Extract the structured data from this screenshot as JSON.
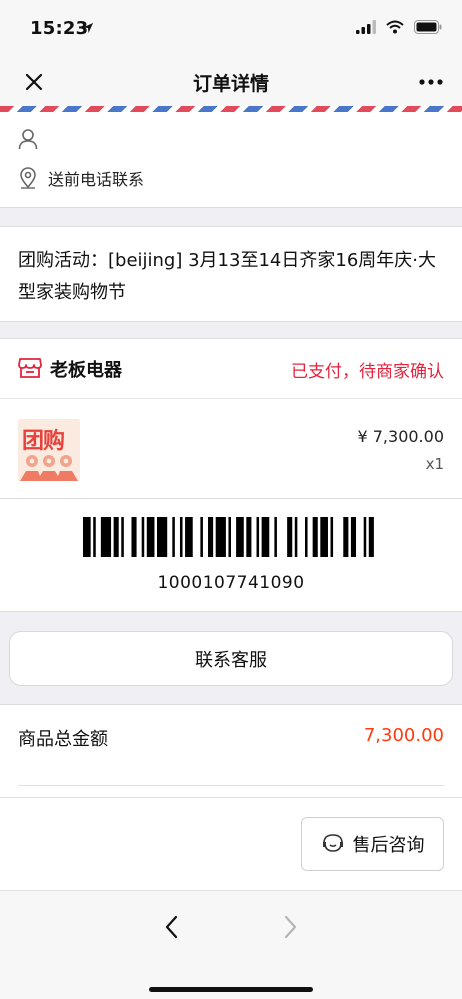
{
  "status_bar": {
    "time": "15:23"
  },
  "nav": {
    "title": "订单详情"
  },
  "contact": {
    "note": "送前电话联系"
  },
  "activity": {
    "text": "团购活动：[beijing] 3月13至14日齐家16周年庆·大型家装购物节"
  },
  "store": {
    "name": "老板电器",
    "status": "已支付，待商家确认"
  },
  "product": {
    "thumb_label": "团购",
    "price": "¥ 7,300.00",
    "qty": "x1"
  },
  "barcode": {
    "number": "1000107741090"
  },
  "buttons": {
    "contact_service": "联系客服",
    "after_sales": "售后咨询"
  },
  "total": {
    "label": "商品总金额",
    "value": "7,300.00"
  },
  "colors": {
    "status_red": "#e6223c",
    "price_orange": "#ff3b10"
  }
}
